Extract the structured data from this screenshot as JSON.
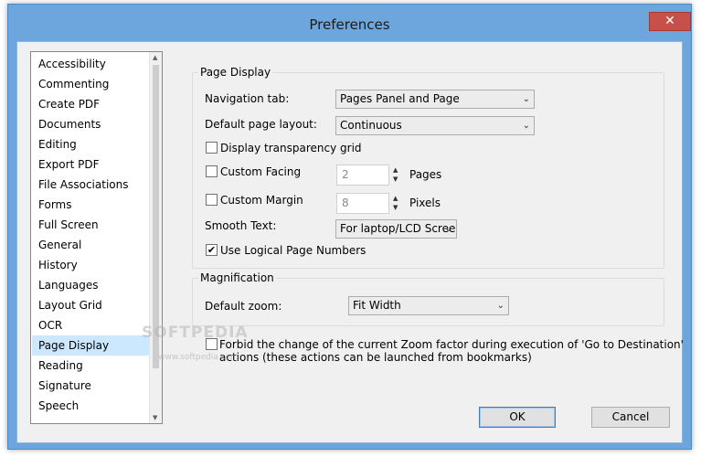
{
  "window": {
    "title": "Preferences",
    "close_glyph": "✕",
    "accent_color": "#6ca6dd"
  },
  "sidebar": {
    "items": [
      {
        "label": "Accessibility"
      },
      {
        "label": "Commenting"
      },
      {
        "label": "Create PDF"
      },
      {
        "label": "Documents"
      },
      {
        "label": "Editing"
      },
      {
        "label": "Export PDF"
      },
      {
        "label": "File Associations"
      },
      {
        "label": "Forms"
      },
      {
        "label": "Full Screen"
      },
      {
        "label": "General"
      },
      {
        "label": "History"
      },
      {
        "label": "Languages"
      },
      {
        "label": "Layout Grid"
      },
      {
        "label": "OCR"
      },
      {
        "label": "Page Display",
        "selected": true
      },
      {
        "label": "Reading"
      },
      {
        "label": "Signature"
      },
      {
        "label": "Speech"
      }
    ],
    "selected_color": "#cce8ff"
  },
  "page_display": {
    "group_title": "Page Display",
    "navigation_tab_label": "Navigation tab:",
    "navigation_tab_value": "Pages Panel and Page",
    "default_layout_label": "Default page layout:",
    "default_layout_value": "Continuous",
    "transparency_grid_label": "Display transparency grid",
    "transparency_grid_checked": false,
    "custom_facing_label": "Custom Facing",
    "custom_facing_checked": false,
    "custom_facing_value": "2",
    "custom_facing_unit": "Pages",
    "custom_margin_label": "Custom Margin",
    "custom_margin_checked": false,
    "custom_margin_value": "8",
    "custom_margin_unit": "Pixels",
    "smooth_text_label": "Smooth Text:",
    "smooth_text_value": "For laptop/LCD Screer",
    "logical_page_numbers_label": "Use Logical Page Numbers",
    "logical_page_numbers_checked": true,
    "check_glyph": "✔"
  },
  "magnification": {
    "group_title": "Magnification",
    "default_zoom_label": "Default zoom:",
    "default_zoom_value": "Fit Width"
  },
  "forbid_zoom": {
    "checked": false,
    "line1": "Forbid the change of the current Zoom factor during execution of  'Go to Destination'",
    "line2": "actions (these actions can be launched from bookmarks)"
  },
  "buttons": {
    "ok": "OK",
    "cancel": "Cancel"
  },
  "watermark": {
    "text": "SOFTPEDIA",
    "url": "www.softpedia.com"
  },
  "icons": {
    "chevron": "⌄",
    "up": "▲",
    "down": "▼"
  }
}
